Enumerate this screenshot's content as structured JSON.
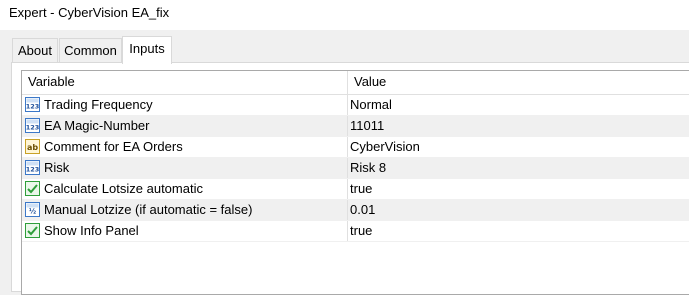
{
  "window": {
    "title": "Expert - CyberVision EA_fix"
  },
  "tabs": [
    {
      "label": "About",
      "active": false
    },
    {
      "label": "Common",
      "active": false
    },
    {
      "label": "Inputs",
      "active": true
    }
  ],
  "grid": {
    "columns": [
      "Variable",
      "Value"
    ],
    "rows": [
      {
        "type_icon": "integer-icon",
        "variable": "Trading Frequency",
        "value": "Normal"
      },
      {
        "type_icon": "integer-icon",
        "variable": "EA Magic-Number",
        "value": "11011"
      },
      {
        "type_icon": "string-icon",
        "variable": "Comment for EA Orders",
        "value": "CyberVision"
      },
      {
        "type_icon": "integer-icon",
        "variable": "Risk",
        "value": "Risk 8"
      },
      {
        "type_icon": "boolean-icon",
        "variable": "Calculate Lotsize automatic",
        "value": "true"
      },
      {
        "type_icon": "double-icon",
        "variable": "Manual Lotzize (if automatic = false)",
        "value": "0.01"
      },
      {
        "type_icon": "boolean-icon",
        "variable": "Show Info Panel",
        "value": "true"
      }
    ]
  },
  "colors": {
    "alt_row": "#f0f0f0",
    "icon_blue": "#3c78c8",
    "icon_yellow": "#e8c23a",
    "icon_green": "#2e9e3a"
  }
}
